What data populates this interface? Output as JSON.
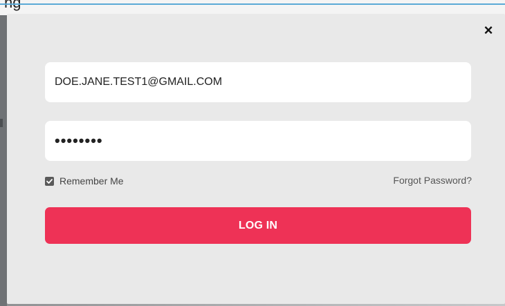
{
  "background": {
    "partial_heading": "ng"
  },
  "modal": {
    "close_glyph": "×",
    "email_value": "DOE.JANE.TEST1@GMAIL.COM",
    "password_masked": "••••••••",
    "remember_label": "Remember Me",
    "remember_checked": true,
    "forgot_label": "Forgot Password?",
    "login_label": "LOG IN"
  },
  "colors": {
    "modal_bg": "#e9e9e9",
    "field_bg": "#ffffff",
    "accent": "#ee3256",
    "checkbox": "#5a5a5a"
  },
  "icons": {
    "close": "close-icon",
    "check": "checkmark-icon"
  }
}
